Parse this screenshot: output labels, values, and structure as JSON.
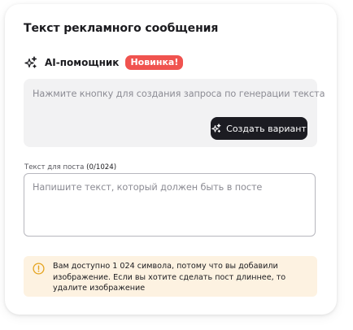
{
  "section": {
    "title": "Текст рекламного сообщения"
  },
  "ai_helper": {
    "label": "AI-помощник",
    "badge": "Новинка!",
    "hint": "Нажмите кнопку для создания запроса по генерации текста",
    "button_label": "Создать вариант",
    "icon": "sparkles-icon"
  },
  "post_text": {
    "label": "Текст для поста",
    "counter": "(0/1024)",
    "value": "",
    "placeholder": "Напишите текст, который должен быть в посте"
  },
  "notice": {
    "icon": "warning-circle-icon",
    "text": "Вам доступно 1 024 символа, потому что вы добавили изображение. Если вы хотите сделать пост длиннее, то удалите изображение"
  },
  "colors": {
    "badge": "#f0534f",
    "button": "#1c1c22",
    "notice_bg": "#fdf2e1",
    "warning": "#e5a31d",
    "ai_box_bg": "#f2f2f3"
  }
}
